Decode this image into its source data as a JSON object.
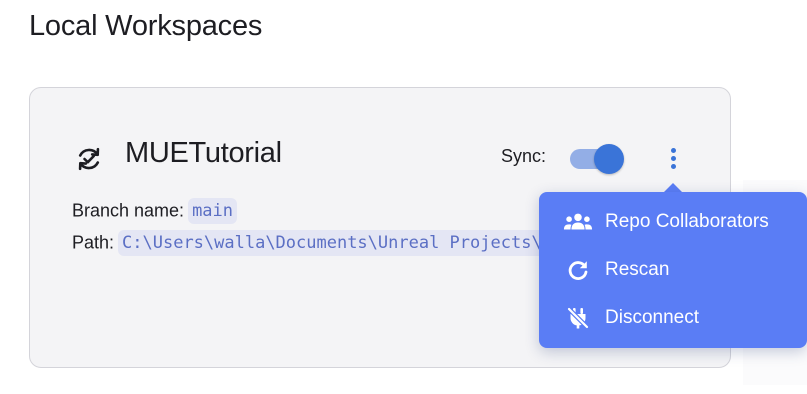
{
  "header": {
    "title": "Local Workspaces"
  },
  "workspace": {
    "icon": "sync-check-icon",
    "name": "MUETutorial",
    "sync_label": "Sync:",
    "sync_enabled": true,
    "branch_label": "Branch name:",
    "branch_value": "main",
    "path_label": "Path:",
    "path_value": "C:\\Users\\walla\\Documents\\Unreal Projects\\MUETutorial"
  },
  "menu": {
    "items": [
      {
        "label": "Repo Collaborators",
        "icon": "users-icon"
      },
      {
        "label": "Rescan",
        "icon": "refresh-icon"
      },
      {
        "label": "Disconnect",
        "icon": "plug-off-icon"
      }
    ]
  },
  "colors": {
    "accent": "#3a74d8",
    "menu_bg": "#5a7df5",
    "card_bg": "#f4f4f6",
    "code_text": "#5b6fc4",
    "code_bg": "#e4e6f4"
  }
}
